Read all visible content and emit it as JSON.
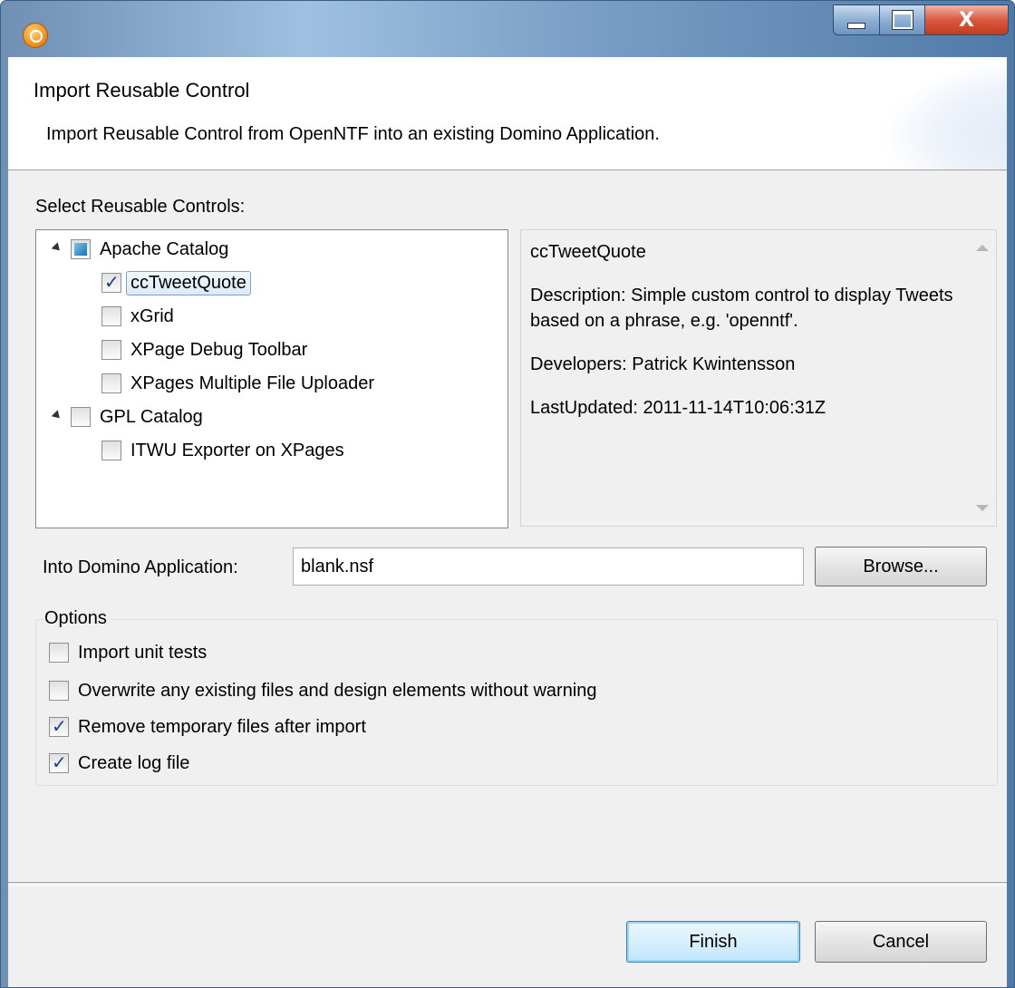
{
  "window": {
    "title": ""
  },
  "titlebar": {
    "close_glyph": "X"
  },
  "banner": {
    "title": "Import Reusable Control",
    "description": "Import Reusable Control from OpenNTF into an existing Domino Application."
  },
  "controls": {
    "label": "Select Reusable Controls:",
    "tree": [
      {
        "label": "Apache Catalog",
        "state": "partial",
        "expanded": true,
        "children": [
          {
            "label": "ccTweetQuote",
            "checked": true,
            "selected": true
          },
          {
            "label": "xGrid",
            "checked": false
          },
          {
            "label": "XPage Debug Toolbar",
            "checked": false
          },
          {
            "label": "XPages Multiple File Uploader",
            "checked": false
          }
        ]
      },
      {
        "label": "GPL Catalog",
        "state": "unchecked",
        "expanded": true,
        "children": [
          {
            "label": "ITWU Exporter on XPages",
            "checked": false
          }
        ]
      }
    ]
  },
  "details": {
    "name": "ccTweetQuote",
    "description": "Description: Simple custom control to display Tweets based on a phrase, e.g. 'openntf'.",
    "developers": "Developers: Patrick Kwintensson",
    "last_updated": "LastUpdated: 2011-11-14T10:06:31Z"
  },
  "target": {
    "label": "Into Domino Application:",
    "value": "blank.nsf",
    "browse_label": "Browse..."
  },
  "options": {
    "legend": "Options",
    "items": [
      {
        "label": "Import unit tests",
        "checked": false
      },
      {
        "label": "Overwrite any existing files and design elements without warning",
        "checked": false
      },
      {
        "label": "Remove temporary files after import",
        "checked": true
      },
      {
        "label": "Create log file",
        "checked": true
      }
    ]
  },
  "footer": {
    "finish_label": "Finish",
    "cancel_label": "Cancel"
  },
  "colors": {
    "titlebar": "#7da1c8",
    "dialog_bg": "#f0f0f0",
    "close_button": "#d9593f",
    "check_mark": "#1f3b8b"
  }
}
